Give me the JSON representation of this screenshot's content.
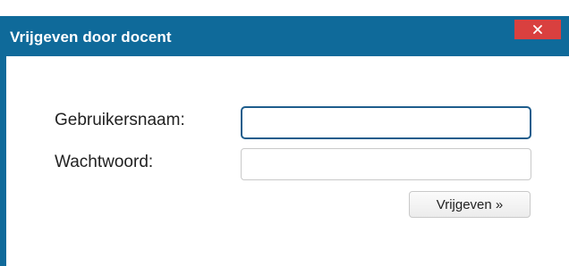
{
  "dialog": {
    "title": "Vrijgeven door docent",
    "close_icon": "close-icon"
  },
  "form": {
    "username_label": "Gebruikersnaam:",
    "username_value": "",
    "password_label": "Wachtwoord:",
    "password_value": "",
    "submit_label": "Vrijgeven »"
  },
  "colors": {
    "titlebar": "#0f6a9a",
    "close_button": "#d9403f",
    "focused_input_border": "#1e5d8c"
  }
}
